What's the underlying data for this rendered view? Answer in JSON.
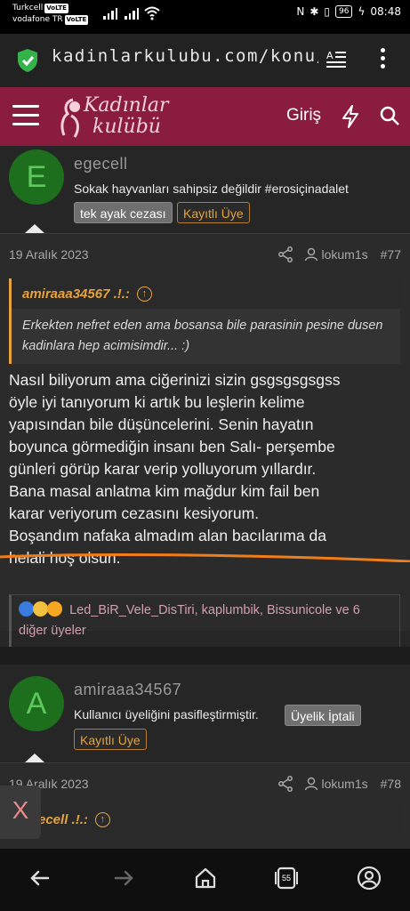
{
  "status_bar": {
    "carrier1": "Turkcell",
    "carrier2": "vodafone TR",
    "volte": "VoLTE",
    "battery": "96",
    "time": "08:48"
  },
  "browser": {
    "url": "kadinlarkulubu.com/konu/esi"
  },
  "site": {
    "logo_line1": "Kadınlar",
    "logo_line2": "kulübü",
    "login_label": "Giriş"
  },
  "posts": [
    {
      "author_initial": "E",
      "author": "egecell",
      "status": "Sokak hayvanları sahipsiz değildir #erosiçinadalet",
      "badges": [
        "tek ayak cezası",
        "Kayıtlı Üye"
      ]
    },
    {
      "date": "19 Aralık 2023",
      "quoted_user": "lokum1s",
      "number": "#77",
      "quote_author": "amiraaa34567 .!.:",
      "quote_text": "Erkekten nefret eden ama bosansa bile parasinin pesine dusen kadinlara hep acimisimdir... :)",
      "body": [
        "Nasıl biliyorum ama ciğerinizi sizin gsgsgsgsgss",
        "öyle iyi tanıyorum ki artık bu leşlerin kelime",
        "yapısından bile düşüncelerini. Senin hayatın",
        "boyunca görmediğin insanı ben Salı- perşembe",
        "günleri görüp karar verip yolluyorum yıllardır.",
        "Bana masal anlatma kim mağdur kim fail ben",
        "karar veriyorum cezasını kesiyorum.",
        "Boşandım nafaka almadım alan bacılarıma da",
        "helali hoş olsun."
      ],
      "reactions": "Led_BiR_Vele_DisTiri, kaplumbik, Bissunicole ve 6 diğer üyeler"
    },
    {
      "author_initial": "A",
      "author": "amiraaa34567",
      "status": "Kullanıcı üyeliğini pasifleştirmiştir.",
      "badges": [
        "Üyelik İptali",
        "Kayıtlı Üye"
      ]
    },
    {
      "date": "19 Aralık 2023",
      "quoted_user": "lokum1s",
      "number": "#78",
      "quote_author": "ecell .!.:"
    }
  ],
  "floating": {
    "close_label": "X"
  },
  "nav": {
    "tab_count": "55"
  },
  "colors": {
    "header": "#8a1d3e",
    "accent": "#e7a33b",
    "avatar_green": "#1d6f1d",
    "underline": "#f07d18"
  }
}
